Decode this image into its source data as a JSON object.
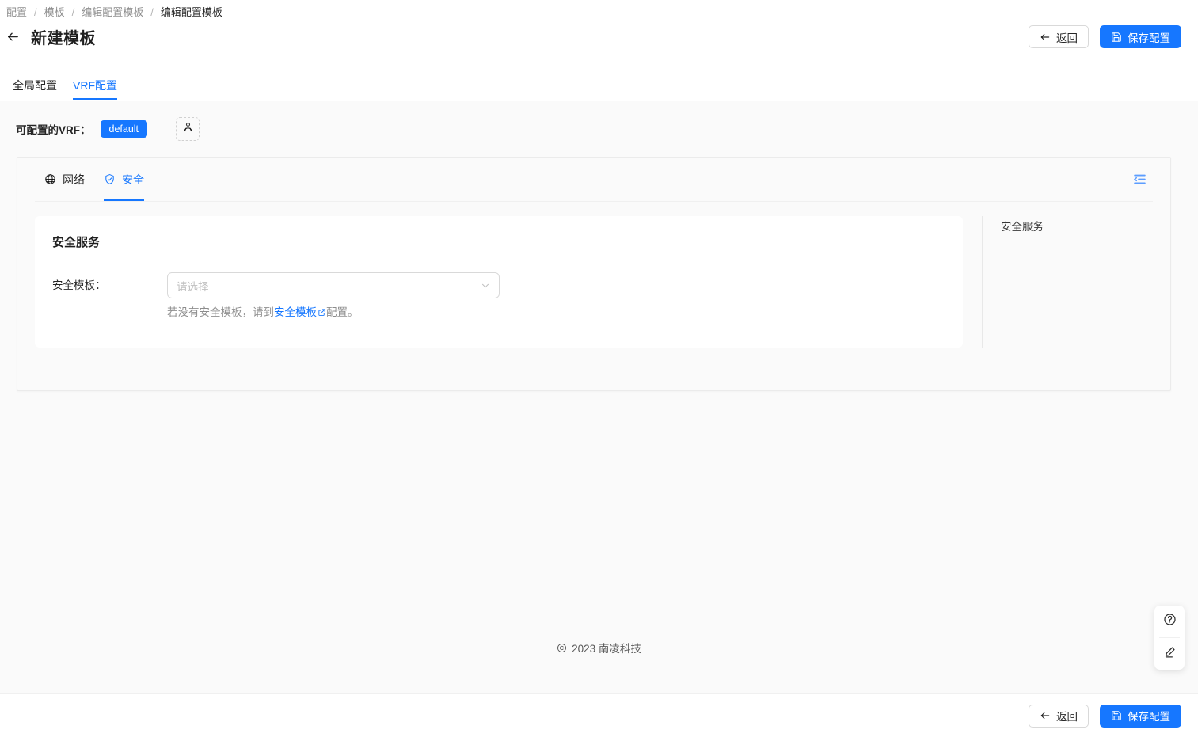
{
  "breadcrumb": [
    {
      "label": "配置"
    },
    {
      "label": "模板"
    },
    {
      "label": "编辑配置模板"
    },
    {
      "label": "编辑配置模板"
    }
  ],
  "header": {
    "title": "新建模板",
    "back_icon": "arrow-left-icon",
    "back_label": "返回",
    "save_label": "保存配置",
    "save_icon": "save-icon",
    "accent_color": "#1677ff"
  },
  "top_tabs": [
    {
      "label": "全局配置",
      "active": false
    },
    {
      "label": "VRF配置",
      "active": true
    }
  ],
  "vrf": {
    "label": "可配置的VRF：",
    "tag": "default",
    "add_icon": "user-add-icon"
  },
  "inner_tabs": [
    {
      "label": "网络",
      "icon": "globe-icon",
      "active": false
    },
    {
      "label": "安全",
      "icon": "shield-check-icon",
      "active": true
    }
  ],
  "fold_icon": "menu-unfold-icon",
  "card": {
    "title": "安全服务",
    "form": {
      "label": "安全模板：",
      "placeholder": "请选择",
      "value": "",
      "chevron_icon": "chevron-down-icon",
      "hint_prefix": "若没有安全模板，请到",
      "hint_link": "安全模板",
      "hint_link_icon": "external-link-icon",
      "hint_suffix": "配置。"
    }
  },
  "anchor_nav": [
    {
      "label": "安全服务"
    }
  ],
  "float_widget": {
    "help_icon": "question-circle-icon",
    "edit_icon": "pencil-icon"
  },
  "footer": {
    "copyright_icon": "copyright-icon",
    "text": "2023 南凌科技"
  },
  "bottom_bar": {
    "back_label": "返回",
    "save_label": "保存配置"
  }
}
